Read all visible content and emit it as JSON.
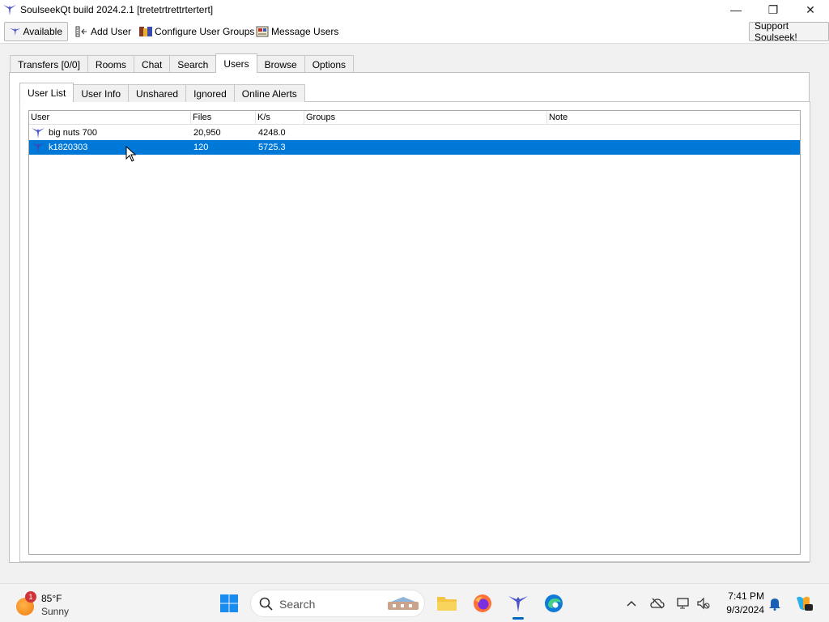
{
  "window": {
    "title": "SoulseekQt build 2024.2.1 [tretetrtrettrtertert]",
    "minimize_glyph": "—",
    "maximize_glyph": "❐",
    "close_glyph": "✕"
  },
  "toolbar": {
    "status_label": "Available",
    "add_user_label": "Add User",
    "configure_groups_label": "Configure User Groups",
    "message_users_label": "Message Users",
    "support_label": "Support Soulseek!"
  },
  "main_tabs": [
    {
      "label": "Transfers [0/0]"
    },
    {
      "label": "Rooms"
    },
    {
      "label": "Chat"
    },
    {
      "label": "Search"
    },
    {
      "label": "Users",
      "active": true
    },
    {
      "label": "Browse"
    },
    {
      "label": "Options"
    }
  ],
  "sub_tabs": [
    {
      "label": "User List",
      "active": true
    },
    {
      "label": "User Info"
    },
    {
      "label": "Unshared"
    },
    {
      "label": "Ignored"
    },
    {
      "label": "Online Alerts"
    }
  ],
  "table": {
    "columns": [
      "User",
      "Files",
      "K/s",
      "Groups",
      "Note"
    ],
    "rows": [
      {
        "user": "big nuts 700",
        "files": "20,950",
        "kps": "4248.0",
        "groups": "",
        "note": "",
        "selected": false
      },
      {
        "user": "k1820303",
        "files": "120",
        "kps": "5725.3",
        "groups": "",
        "note": "",
        "selected": true
      }
    ]
  },
  "taskbar": {
    "weather_temp": "85°F",
    "weather_condition": "Sunny",
    "weather_badge": "1",
    "search_placeholder": "Search",
    "time": "7:41 PM",
    "date": "9/3/2024",
    "icons": [
      "start-icon",
      "search-icon",
      "file-explorer-icon",
      "firefox-icon",
      "soulseek-icon",
      "edge-icon"
    ]
  },
  "colors": {
    "selection": "#0078d7",
    "soulseek_bird": "#4a55c9",
    "taskbar_accent": "#0067c0"
  }
}
